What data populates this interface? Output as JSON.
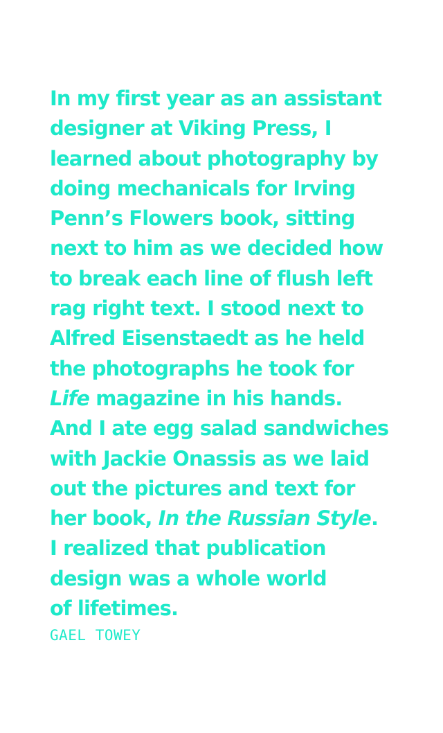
{
  "colors": {
    "text": "#1de9c9",
    "background": "#ffffff"
  },
  "quote": {
    "line_01": "In my first year as an assistant",
    "line_02": "designer at Viking Press, I",
    "line_03": "learned about photography by",
    "line_04": "doing mechanicals for Irving",
    "line_05": "Penn’s Flowers book, sitting",
    "line_06": "next to him as we decided how",
    "line_07": "to break each line of flush left",
    "line_08": "rag right text. I stood next to",
    "line_09": "Alfred Eisenstaedt as he held",
    "line_10": "the photographs he took for",
    "line_11_italic": "Life",
    "line_11_rest": " magazine in his hands.",
    "line_12": "And I ate egg salad sandwiches",
    "line_13": "with Jackie Onassis as we laid",
    "line_14": "out the pictures and text for",
    "line_15_start": "her book, ",
    "line_15_italic": "In the Russian Style",
    "line_15_end": ".",
    "line_16": "I realized that publication",
    "line_17": "design was a whole world",
    "line_18": "of lifetimes."
  },
  "attribution": "GAEL TOWEY"
}
